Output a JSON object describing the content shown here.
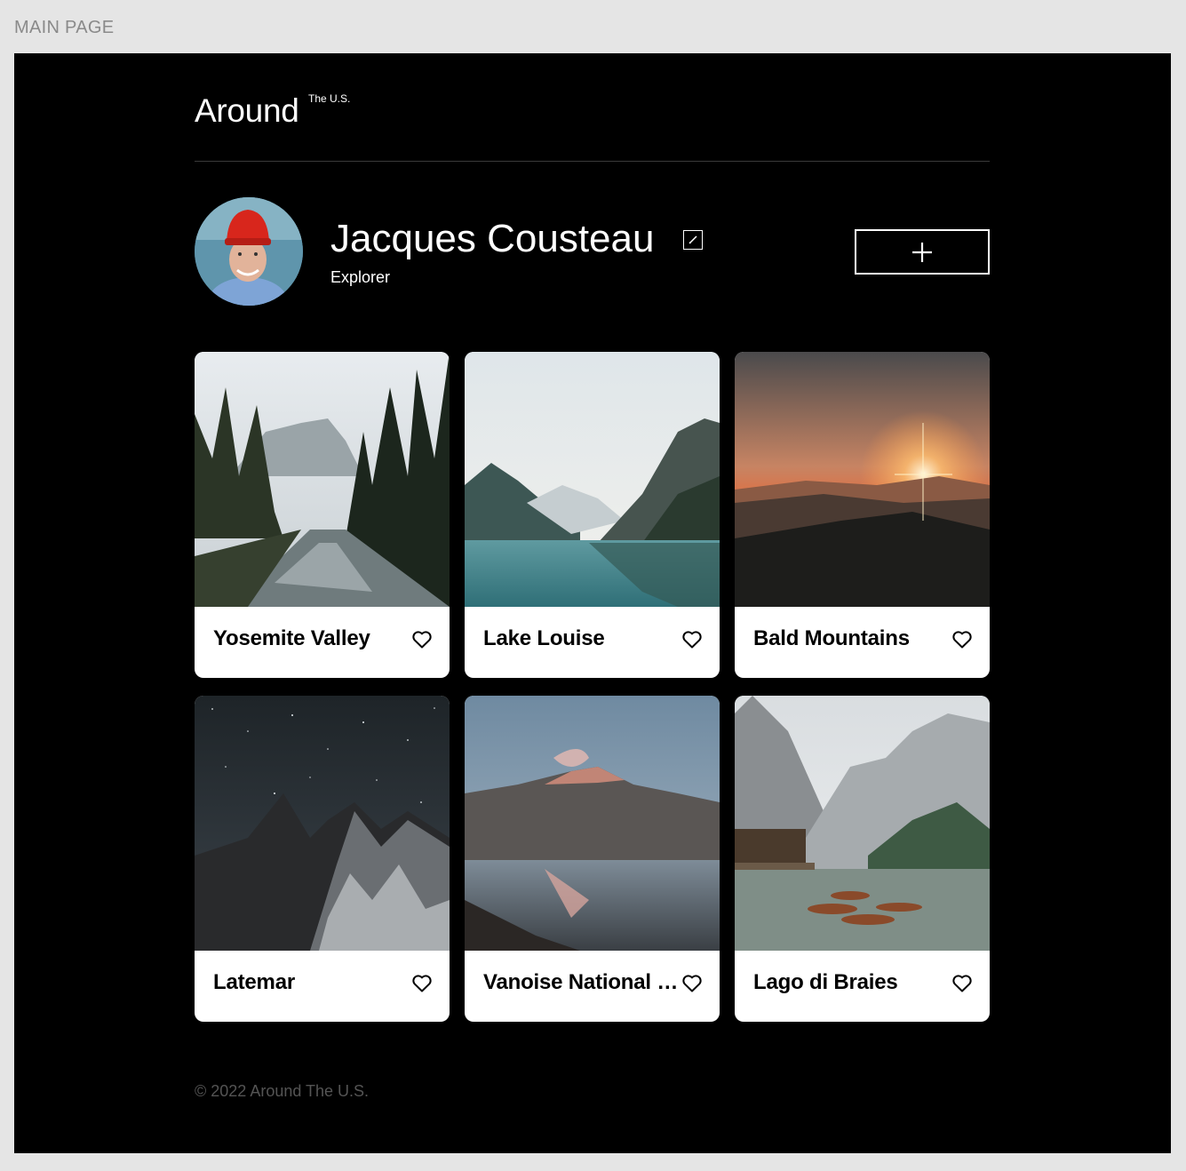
{
  "frame_label": "MAIN PAGE",
  "header": {
    "logo": "Around",
    "logo_sup": "The U.S."
  },
  "profile": {
    "name": "Jacques Cousteau",
    "job": "Explorer"
  },
  "cards": [
    {
      "title": "Yosemite Valley"
    },
    {
      "title": "Lake Louise"
    },
    {
      "title": "Bald Mountains"
    },
    {
      "title": "Latemar"
    },
    {
      "title": "Vanoise National Park"
    },
    {
      "title": "Lago di Braies"
    }
  ],
  "footer": {
    "copyright": "© 2022 Around The U.S."
  },
  "icons": {
    "edit": "pencil-icon",
    "add": "plus-icon",
    "like": "heart-icon"
  },
  "colors": {
    "page_bg": "#000000",
    "card_bg": "#ffffff",
    "canvas_bg": "#e5e5e5"
  }
}
